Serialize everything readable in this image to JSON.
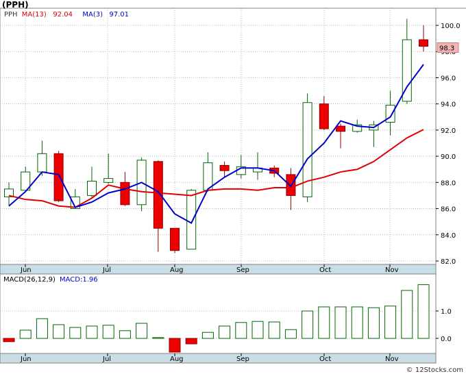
{
  "title": "(PPH)",
  "credit": "© 12Stocks.com",
  "chart_data": [
    {
      "type": "candlestick",
      "symbol": "PPH",
      "legend": [
        {
          "label": "PPH",
          "color": "#3a3a3a"
        },
        {
          "label": "MA(13)",
          "value": "92.04",
          "color": "#e00000"
        },
        {
          "label": "MA(3)",
          "value": "97.01",
          "color": "#0000cc"
        }
      ],
      "last_price_label": "98.3",
      "ylim": [
        81.2,
        101.4
      ],
      "y_ticks": [
        "82.0",
        "84.0",
        "86.0",
        "88.0",
        "90.0",
        "92.0",
        "94.0",
        "96.0",
        "98.0",
        "100.0"
      ],
      "x_month_labels": [
        "Jun",
        "Jul",
        "Aug",
        "Sep",
        "Oct",
        "Nov"
      ],
      "candles": [
        {
          "o": 86.9,
          "h": 88.0,
          "l": 86.2,
          "c": 87.5
        },
        {
          "o": 87.4,
          "h": 89.2,
          "l": 87.3,
          "c": 88.8
        },
        {
          "o": 88.8,
          "h": 91.2,
          "l": 88.5,
          "c": 90.2
        },
        {
          "o": 90.2,
          "h": 90.4,
          "l": 86.5,
          "c": 86.6
        },
        {
          "o": 86.0,
          "h": 87.5,
          "l": 86.0,
          "c": 86.9
        },
        {
          "o": 87.0,
          "h": 89.2,
          "l": 86.8,
          "c": 88.1
        },
        {
          "o": 88.0,
          "h": 90.2,
          "l": 87.9,
          "c": 88.3
        },
        {
          "o": 88.0,
          "h": 88.8,
          "l": 86.2,
          "c": 86.3
        },
        {
          "o": 86.3,
          "h": 89.9,
          "l": 85.8,
          "c": 89.7
        },
        {
          "o": 89.6,
          "h": 89.7,
          "l": 82.7,
          "c": 84.5
        },
        {
          "o": 84.5,
          "h": 84.5,
          "l": 82.6,
          "c": 82.8
        },
        {
          "o": 82.9,
          "h": 87.5,
          "l": 82.9,
          "c": 87.4
        },
        {
          "o": 87.4,
          "h": 90.3,
          "l": 87.3,
          "c": 89.5
        },
        {
          "o": 89.3,
          "h": 89.6,
          "l": 88.4,
          "c": 88.9
        },
        {
          "o": 88.6,
          "h": 90.1,
          "l": 88.3,
          "c": 89.2
        },
        {
          "o": 88.8,
          "h": 90.3,
          "l": 88.2,
          "c": 89.1
        },
        {
          "o": 89.1,
          "h": 89.3,
          "l": 88.4,
          "c": 88.7
        },
        {
          "o": 88.6,
          "h": 89.1,
          "l": 85.9,
          "c": 87.0
        },
        {
          "o": 86.9,
          "h": 94.8,
          "l": 86.5,
          "c": 94.1
        },
        {
          "o": 94.0,
          "h": 94.6,
          "l": 92.0,
          "c": 92.1
        },
        {
          "o": 92.3,
          "h": 92.5,
          "l": 90.6,
          "c": 91.9
        },
        {
          "o": 91.9,
          "h": 92.8,
          "l": 91.8,
          "c": 92.4
        },
        {
          "o": 92.0,
          "h": 92.7,
          "l": 90.7,
          "c": 92.4
        },
        {
          "o": 92.6,
          "h": 95.0,
          "l": 91.6,
          "c": 93.9
        },
        {
          "o": 94.2,
          "h": 100.5,
          "l": 94.0,
          "c": 98.9
        },
        {
          "o": 98.9,
          "h": 100.0,
          "l": 98.0,
          "c": 98.4
        }
      ],
      "ma13": [
        87.0,
        86.7,
        86.6,
        86.2,
        86.1,
        86.8,
        87.8,
        87.5,
        87.3,
        87.2,
        87.1,
        87.0,
        87.4,
        87.5,
        87.5,
        87.4,
        87.6,
        87.6,
        88.1,
        88.4,
        88.8,
        89.0,
        89.6,
        90.5,
        91.4,
        92.04
      ],
      "ma3": [
        86.2,
        87.3,
        88.8,
        88.6,
        86.1,
        86.5,
        87.2,
        87.5,
        88.0,
        87.3,
        85.6,
        84.9,
        87.5,
        88.4,
        89.1,
        89.1,
        88.9,
        87.7,
        89.8,
        91.0,
        92.7,
        92.3,
        92.2,
        93.0,
        95.3,
        97.01
      ]
    },
    {
      "type": "bar",
      "title": "MACD(26,12,9)",
      "value_label": "MACD:1.96",
      "ylim": [
        -0.5,
        2.0
      ],
      "y_ticks": [
        "0.0",
        "1.0"
      ],
      "x_month_labels": [
        "Jun",
        "Jul",
        "Aug",
        "Sep",
        "Oct",
        "Nov"
      ],
      "values": [
        -0.12,
        0.3,
        0.72,
        0.5,
        0.4,
        0.45,
        0.48,
        0.28,
        0.55,
        0.03,
        -0.5,
        -0.2,
        0.22,
        0.45,
        0.58,
        0.62,
        0.6,
        0.32,
        1.0,
        1.15,
        1.15,
        1.15,
        1.12,
        1.18,
        1.75,
        1.96
      ]
    }
  ]
}
